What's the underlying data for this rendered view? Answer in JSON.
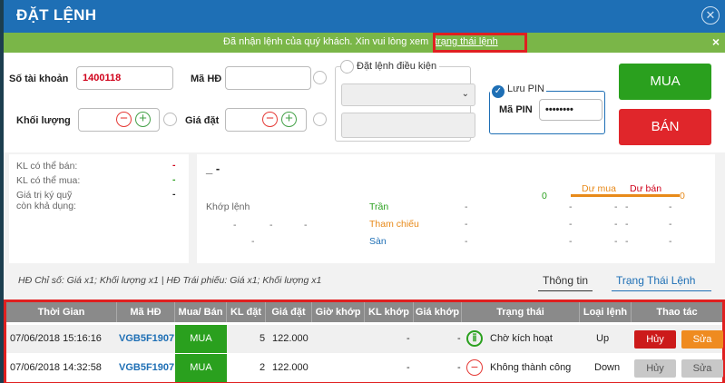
{
  "title": "ĐẶT LỆNH",
  "notice": {
    "text": "Đã nhận lệnh của quý khách. Xin vui lòng xem",
    "link": "trạng thái lệnh",
    "close": "×"
  },
  "form": {
    "account_label": "Số tài khoản",
    "account_value": "1400118",
    "contract_label": "Mã HĐ",
    "contract_value": "",
    "condition_label": "Đặt lệnh điều kiện",
    "quantity_label": "Khối lượng",
    "quantity_value": "",
    "price_label": "Giá đặt",
    "price_value": "",
    "save_pin_label": "Lưu PIN",
    "pin_label": "Mã PIN",
    "pin_value": "••••••••",
    "buy_label": "MUA",
    "sell_label": "BÁN"
  },
  "info_left": [
    {
      "label": "KL có thể bán:",
      "value": "-",
      "color": "#d0021b"
    },
    {
      "label": "KL có thể mua:",
      "value": "-",
      "color": "#2aa01e"
    },
    {
      "label": "Giá trị ký quỹ",
      "value": "-",
      "color": "#222222"
    },
    {
      "label": "còn khả dụng:",
      "value": "",
      "color": "#222222"
    }
  ],
  "info_right": {
    "symbol": "_ -",
    "matched_label": "Khớp lệnh",
    "dash": "-",
    "ceiling_label": "Trần",
    "reference_label": "Tham chiếu",
    "floor_label": "Sàn",
    "zero": "0",
    "bid_label": "Dư mua",
    "ask_label": "Dư bán"
  },
  "footnote": "HĐ Chỉ số: Giá x1; Khối lượng x1 | HĐ Trái phiếu: Giá x1; Khối lượng x1",
  "tabs": [
    "Thông tin",
    "Trạng Thái Lệnh"
  ],
  "table": {
    "headers": [
      "Thời Gian",
      "Mã HĐ",
      "Mua/ Bán",
      "KL đặt",
      "Giá đặt",
      "Giờ khớp",
      "KL khớp",
      "Giá khớp",
      "Trạng thái",
      "Loại lệnh",
      "Thao tác"
    ],
    "rows": [
      {
        "time": "07/06/2018 15:16:16",
        "code": "VGB5F1907",
        "side": "MUA",
        "qty": "5",
        "price": "122.000",
        "match_time": "",
        "match_qty": "-",
        "match_price": "-",
        "status_icon": "pause-clock-icon",
        "status": "Chờ kích hoạt",
        "type": "Up",
        "cancel": "Hủy",
        "edit": "Sửa",
        "enabled": true
      },
      {
        "time": "07/06/2018 14:32:58",
        "code": "VGB5F1907",
        "side": "MUA",
        "qty": "2",
        "price": "122.000",
        "match_time": "",
        "match_qty": "-",
        "match_price": "-",
        "status_icon": "minus-circle-icon",
        "status": "Không thành công",
        "type": "Down",
        "cancel": "Hủy",
        "edit": "Sửa",
        "enabled": false
      }
    ]
  }
}
